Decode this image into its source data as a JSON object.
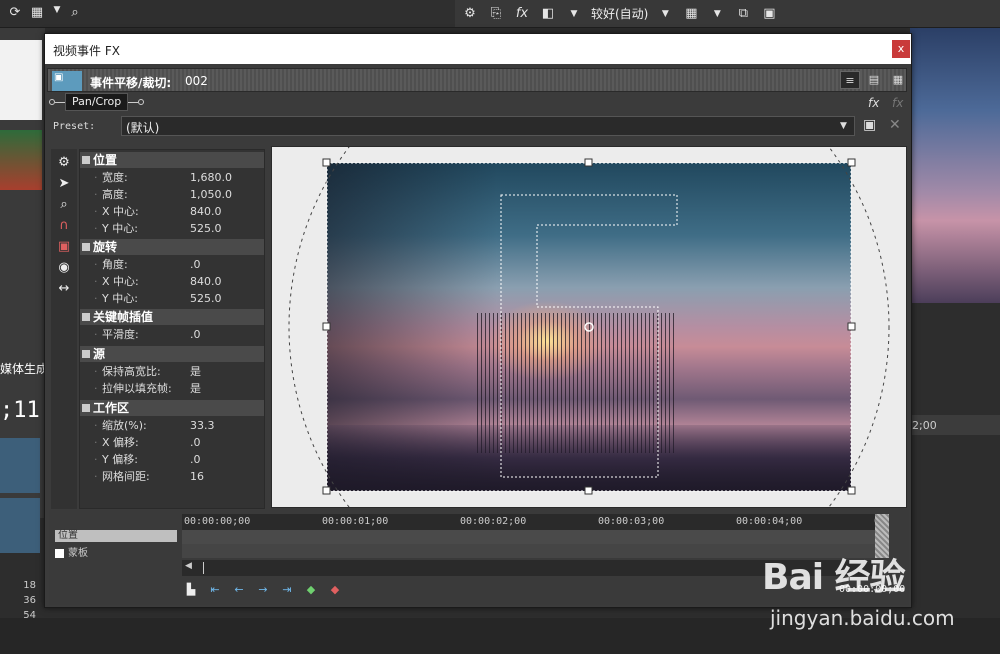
{
  "toolbar_right": {
    "quality_label": "较好(自动)"
  },
  "background": {
    "media_label": "媒体生成器",
    "time": ";11",
    "ruler_numbers": [
      "18",
      "36",
      "54"
    ],
    "right_ruler_time": "2;00"
  },
  "dialog": {
    "title": "视频事件 FX",
    "close_label": "x",
    "header_title": "事件平移/裁切:",
    "header_id": "002",
    "plugin_name": "Pan/Crop",
    "preset_label": "Preset:",
    "preset_value": "(默认)"
  },
  "properties": {
    "sections": [
      {
        "title": "位置",
        "rows": [
          {
            "name": "宽度:",
            "value": "1,680.0"
          },
          {
            "name": "高度:",
            "value": "1,050.0"
          },
          {
            "name": "X 中心:",
            "value": "840.0"
          },
          {
            "name": "Y 中心:",
            "value": "525.0"
          }
        ]
      },
      {
        "title": "旋转",
        "rows": [
          {
            "name": "角度:",
            "value": ".0"
          },
          {
            "name": "X 中心:",
            "value": "840.0"
          },
          {
            "name": "Y 中心:",
            "value": "525.0"
          }
        ]
      },
      {
        "title": "关键帧插值",
        "rows": [
          {
            "name": "平滑度:",
            "value": ".0"
          }
        ]
      },
      {
        "title": "源",
        "rows": [
          {
            "name": "保持高宽比:",
            "value": "是"
          },
          {
            "name": "拉伸以填充帧:",
            "value": "是"
          }
        ]
      },
      {
        "title": "工作区",
        "rows": [
          {
            "name": "缩放(%):",
            "value": "33.3"
          },
          {
            "name": "X 偏移:",
            "value": ".0"
          },
          {
            "name": "Y 偏移:",
            "value": ".0"
          },
          {
            "name": "网格间距:",
            "value": "16"
          }
        ]
      }
    ]
  },
  "timeline": {
    "track_position": "位置",
    "track_mask": "蒙板",
    "ticks": [
      "00:00:00;00",
      "00:00:01;00",
      "00:00:02;00",
      "00:00:03;00",
      "00:00:04;00",
      "00"
    ],
    "timecode": "00:00:00;00"
  },
  "watermark": {
    "logo": "Bai 经验",
    "url": "jingyan.baidu.com"
  },
  "icons": {
    "tools": [
      "gear-icon",
      "pointer-icon",
      "zoom-icon",
      "magnet-icon",
      "lock-aspect-icon",
      "center-icon",
      "stretch-icon"
    ]
  }
}
